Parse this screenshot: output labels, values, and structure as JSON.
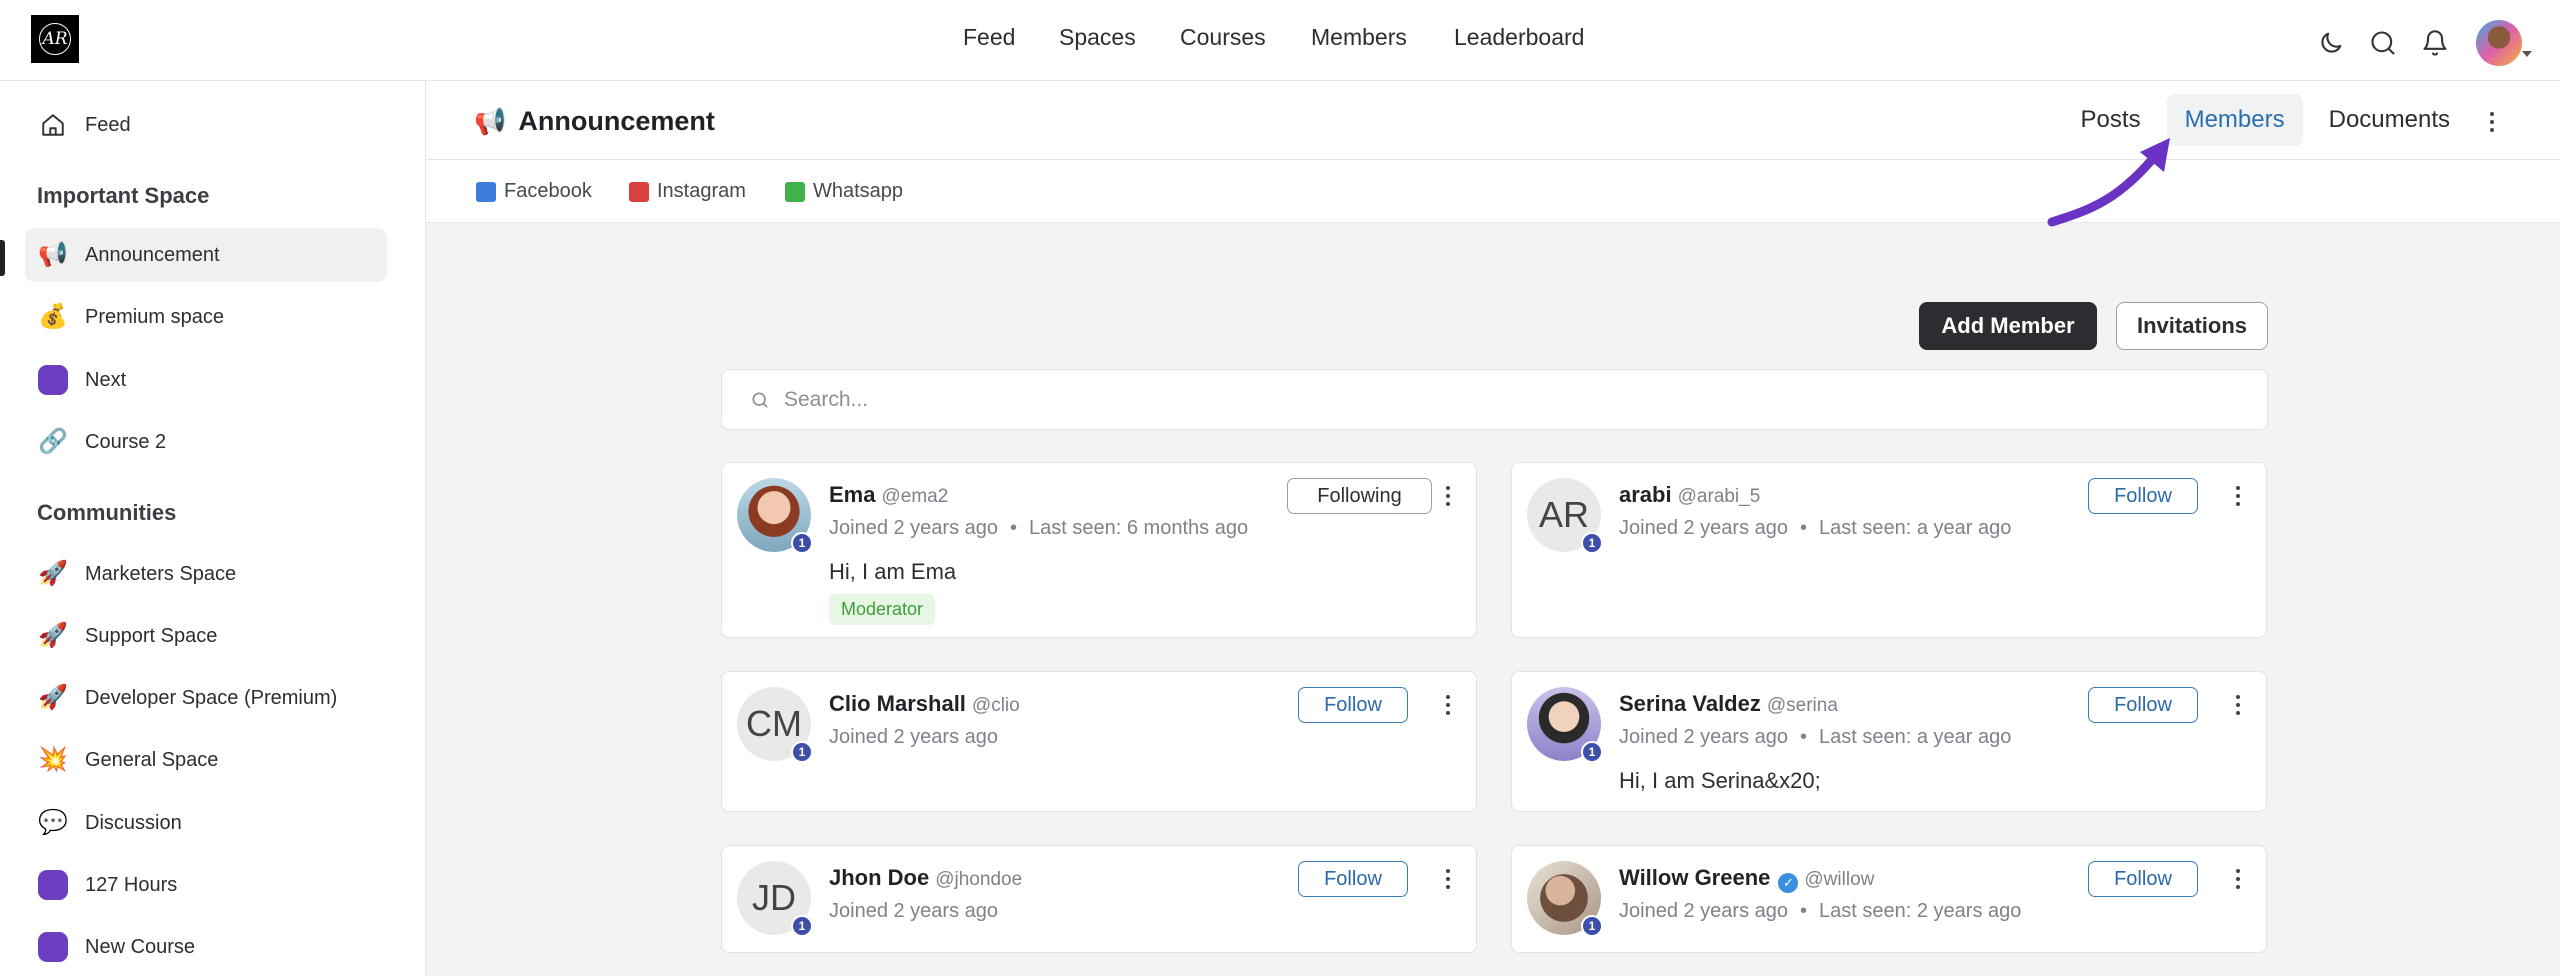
{
  "brand": {
    "logo_text": "AR"
  },
  "topnav": {
    "items": [
      {
        "label": "Feed"
      },
      {
        "label": "Spaces"
      },
      {
        "label": "Courses"
      },
      {
        "label": "Members"
      },
      {
        "label": "Leaderboard"
      }
    ],
    "icons": [
      "moon-icon",
      "search-icon",
      "bell-icon",
      "user-avatar"
    ]
  },
  "sidebar": {
    "feed": {
      "label": "Feed",
      "icon": "home-icon"
    },
    "sections": [
      {
        "title": "Important Space",
        "items": [
          {
            "label": "Announcement",
            "icon": "📢",
            "active": true
          },
          {
            "label": "Premium space",
            "icon": "💰"
          },
          {
            "label": "Next",
            "icon": "purple-square"
          },
          {
            "label": "Course 2",
            "icon": "🔗"
          }
        ]
      },
      {
        "title": "Communities",
        "items": [
          {
            "label": "Marketers Space",
            "icon": "🚀"
          },
          {
            "label": "Support Space",
            "icon": "🚀"
          },
          {
            "label": "Developer Space (Premium)",
            "icon": "🚀"
          },
          {
            "label": "General Space",
            "icon": "💥"
          },
          {
            "label": "Discussion",
            "icon": "💬"
          },
          {
            "label": "127 Hours",
            "icon": "purple-square"
          },
          {
            "label": "New Course",
            "icon": "purple-square"
          }
        ]
      }
    ]
  },
  "space": {
    "icon": "📢",
    "title": "Announcement",
    "tabs": [
      {
        "label": "Posts"
      },
      {
        "label": "Members",
        "active": true
      },
      {
        "label": "Documents"
      }
    ],
    "links": [
      {
        "label": "Facebook",
        "color": "#3b7ddd"
      },
      {
        "label": "Instagram",
        "color": "#d94040"
      },
      {
        "label": "Whatsapp",
        "color": "#3fb24a"
      }
    ]
  },
  "members_page": {
    "add_member_label": "Add Member",
    "invitations_label": "Invitations",
    "search_placeholder": "Search...",
    "members": [
      {
        "name": "Ema",
        "handle": "@ema2",
        "joined": "Joined 2 years ago",
        "last_seen": "Last seen: 6 months ago",
        "bio": "Hi, I am Ema",
        "role": "Moderator",
        "level": "1",
        "avatar": "photo",
        "follow_label": "Following"
      },
      {
        "name": "arabi",
        "handle": "@arabi_5",
        "joined": "Joined 2 years ago",
        "last_seen": "Last seen: a year ago",
        "initials": "AR",
        "level": "1",
        "follow_label": "Follow"
      },
      {
        "name": "Clio Marshall",
        "handle": "@clio",
        "joined": "Joined 2 years ago",
        "initials": "CM",
        "level": "1",
        "follow_label": "Follow"
      },
      {
        "name": "Serina Valdez",
        "handle": "@serina",
        "joined": "Joined 2 years ago",
        "last_seen": "Last seen: a year ago",
        "bio": "Hi, I am Serina&x20;",
        "level": "1",
        "avatar": "photo",
        "follow_label": "Follow"
      },
      {
        "name": "Jhon Doe",
        "handle": "@jhondoe",
        "joined": "Joined 2 years ago",
        "initials": "JD",
        "level": "1",
        "follow_label": "Follow"
      },
      {
        "name": "Willow Greene",
        "handle": "@willow",
        "joined": "Joined 2 years ago",
        "last_seen": "Last seen: 2 years ago",
        "level": "1",
        "avatar": "photo",
        "verified": true,
        "follow_label": "Follow"
      }
    ]
  },
  "colors": {
    "accent": "#2b6fae",
    "annotation_arrow": "#6b33c4",
    "dark_button": "#2b2d31"
  }
}
